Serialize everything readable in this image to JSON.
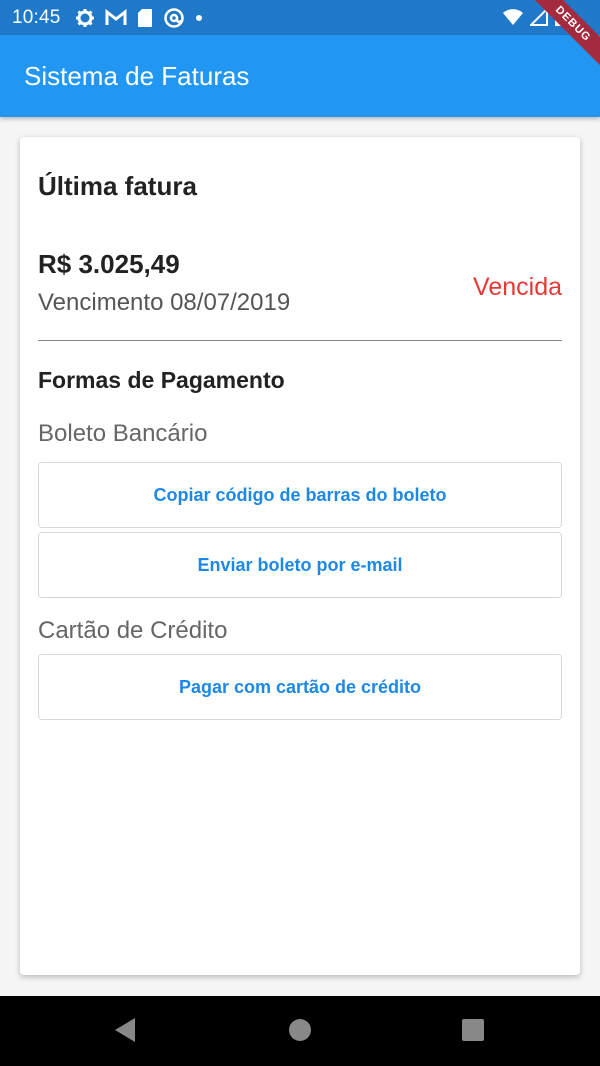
{
  "status_bar": {
    "time": "10:45",
    "icons": [
      "gear-icon",
      "gmail-icon",
      "sd-card-icon",
      "at-sign-icon",
      "dot-icon",
      "wifi-icon",
      "signal-icon",
      "battery-icon"
    ]
  },
  "debug_ribbon": "DEBUG",
  "app_bar": {
    "title": "Sistema de Faturas"
  },
  "invoice": {
    "heading": "Última fatura",
    "amount": "R$ 3.025,49",
    "due_date": "Vencimento 08/07/2019",
    "status": "Vencida",
    "status_color": "#e53935"
  },
  "payment": {
    "section_title": "Formas de Pagamento",
    "boleto": {
      "label": "Boleto Bancário",
      "copy_button": "Copiar código de barras do boleto",
      "email_button": "Enviar boleto por e-mail"
    },
    "card": {
      "label": "Cartão de Crédito",
      "pay_button": "Pagar com cartão de crédito"
    }
  },
  "colors": {
    "primary": "#2196f3",
    "status_bar": "#1f78c8",
    "accent": "#1e88e5"
  },
  "nav_bar": {
    "buttons": [
      "back-icon",
      "home-icon",
      "recents-icon"
    ]
  }
}
